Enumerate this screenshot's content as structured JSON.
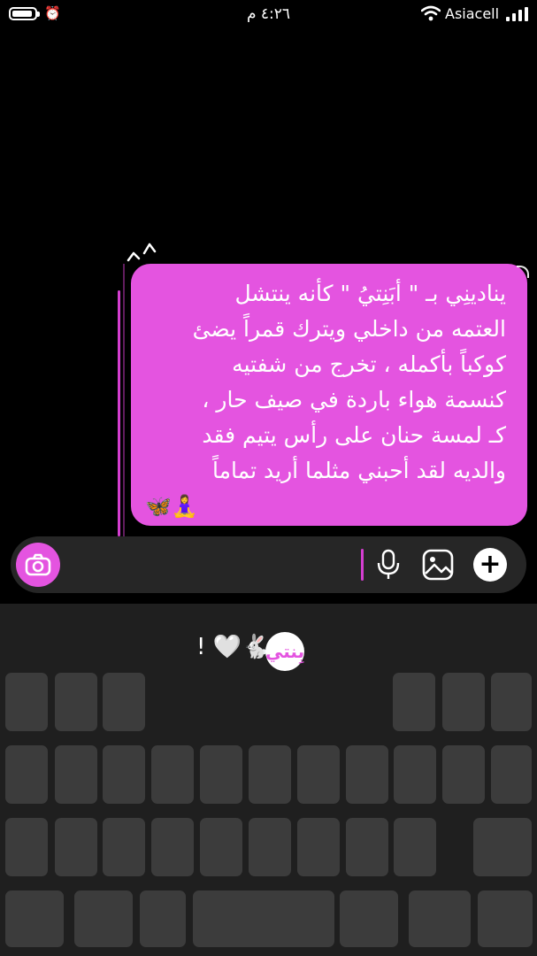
{
  "status_bar": {
    "time": "٤:٢٦ م",
    "carrier": "Asiacell",
    "alarm_icon": "alarm-clock-icon",
    "battery_level": 0.9
  },
  "chat": {
    "accent_color": "#e454e0",
    "message_lines": [
      "ينادينِي بـ \" أبَنِتيُ \" كأنه ينتشل",
      "العتمه من داخلي ويترك قمراً يضئ",
      "كوكباً بأكمله ، تخرج من شفتيه",
      "كنسمة هواء باردة في صيف حار ،",
      "كـ لمسة حنان على رأس يتيم فقد",
      "والديه لقد أحبني مثلما أريد تماماً"
    ],
    "message_emojis": "🦋🧘‍♀️"
  },
  "composer": {
    "camera_icon": "camera-icon",
    "mic_icon": "microphone-icon",
    "gallery_icon": "gallery-icon",
    "plus_label": "+"
  },
  "keyboard": {
    "predictive_text": "! 🤍🐇",
    "sticker_text": "بِنتي"
  }
}
